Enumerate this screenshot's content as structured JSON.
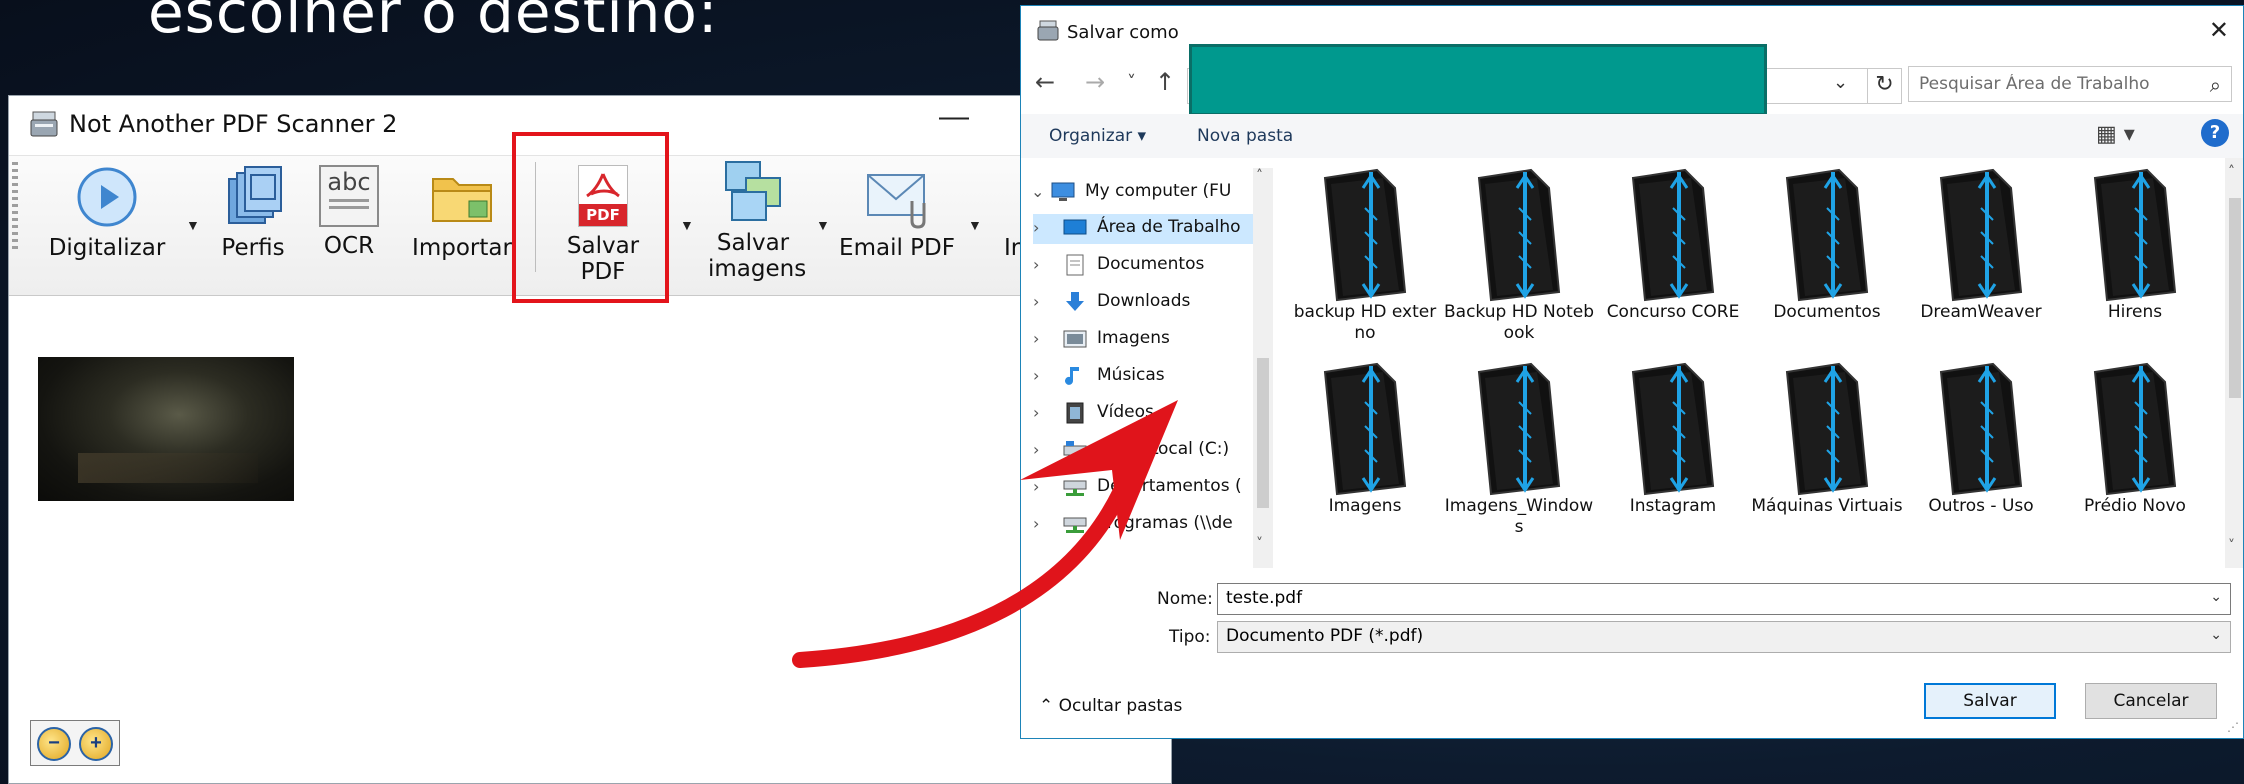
{
  "slide": {
    "heading_partial": "escolher o destino:"
  },
  "naps": {
    "title": "Not Another PDF Scanner 2",
    "minimize": "—",
    "toolbar": [
      {
        "id": "scan",
        "label": "Digitalizar",
        "icon": "scan-play-icon"
      },
      {
        "id": "profiles",
        "label": "Perfis",
        "icon": "profiles-icon"
      },
      {
        "id": "ocr",
        "label": "OCR",
        "icon": "ocr-icon"
      },
      {
        "id": "import",
        "label": "Importar",
        "icon": "folder-icon"
      },
      {
        "id": "savepdf",
        "label": "Salvar PDF",
        "icon": "pdf-icon"
      },
      {
        "id": "saveimg",
        "label": "Salvar imagens",
        "icon": "images-icon"
      },
      {
        "id": "email",
        "label": "Email PDF",
        "icon": "email-icon"
      },
      {
        "id": "print",
        "label": "Ir",
        "icon": "print-icon"
      }
    ],
    "ocr_icon_text": "abc",
    "pdf_icon_text": "PDF",
    "zoom_out": "−",
    "zoom_in": "+"
  },
  "dialog": {
    "title": "Salvar como",
    "close": "✕",
    "nav": {
      "back": "←",
      "forward": "→",
      "recent": "˅",
      "up": "↑"
    },
    "address_drop": "⌄",
    "refresh": "↻",
    "search_placeholder": "Pesquisar Área de Trabalho",
    "search_icon": "⌕",
    "organize": "Organizar ▾",
    "new_folder": "Nova pasta",
    "view_icon": "▦ ▾",
    "help": "?",
    "tree": [
      {
        "label": "My computer (FU",
        "chevron": "⌄",
        "icon": "computer-icon"
      },
      {
        "label": "Área de Trabalho",
        "chevron": "›",
        "icon": "desktop-icon",
        "selected": true
      },
      {
        "label": "Documentos",
        "chevron": "›",
        "icon": "document-icon"
      },
      {
        "label": "Downloads",
        "chevron": "›",
        "icon": "download-icon"
      },
      {
        "label": "Imagens",
        "chevron": "›",
        "icon": "pictures-icon"
      },
      {
        "label": "Músicas",
        "chevron": "›",
        "icon": "music-icon"
      },
      {
        "label": "Vídeos",
        "chevron": "›",
        "icon": "video-icon"
      },
      {
        "label": "Disco Local (C:)",
        "chevron": "›",
        "icon": "drive-icon"
      },
      {
        "label": "Departamentos (",
        "chevron": "›",
        "icon": "network-drive-icon"
      },
      {
        "label": "Programas (\\\\de",
        "chevron": "›",
        "icon": "network-drive-icon"
      }
    ],
    "scroll_up": "˄",
    "scroll_down": "˅",
    "files": [
      {
        "name": "backup HD externo"
      },
      {
        "name": "Backup HD Notebook"
      },
      {
        "name": "Concurso CORE"
      },
      {
        "name": "Documentos"
      },
      {
        "name": "DreamWeaver"
      },
      {
        "name": "Hirens"
      },
      {
        "name": "Imagens"
      },
      {
        "name": "Imagens_Windows"
      },
      {
        "name": "Instagram"
      },
      {
        "name": "Máquinas Virtuais"
      },
      {
        "name": "Outros - Uso"
      },
      {
        "name": "Prédio Novo"
      }
    ],
    "filename_label": "Nome:",
    "filename_value": "teste.pdf",
    "type_label": "Tipo:",
    "type_value": "Documento PDF (*.pdf)",
    "dropdown": "⌄",
    "hide_folders": "⌃ Ocultar pastas",
    "save_button": "Salvar",
    "cancel_button": "Cancelar",
    "resize_grip": "⋰"
  },
  "colors": {
    "highlight": "#e3141b",
    "address_cover": "#00998e",
    "arrow": "#e0141b"
  }
}
